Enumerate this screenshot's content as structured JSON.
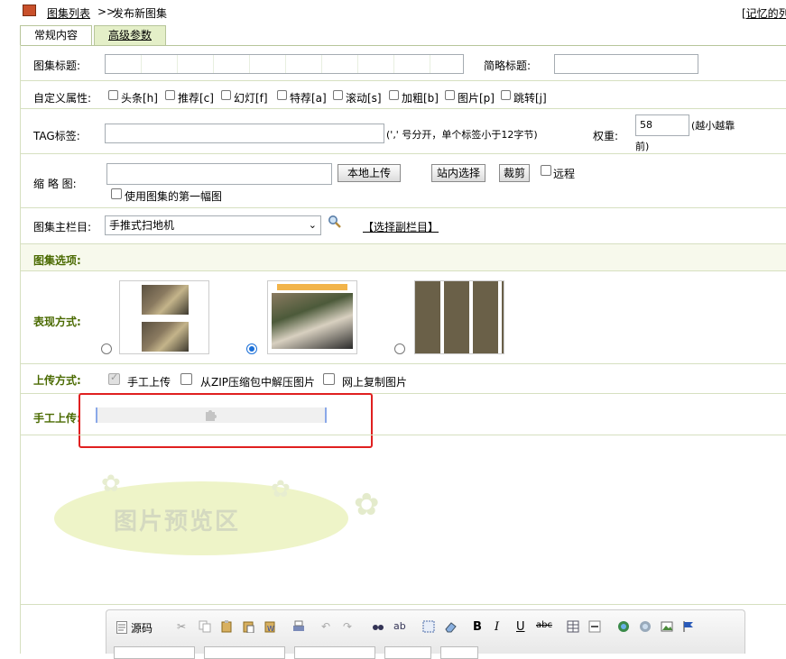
{
  "breadcrumb": {
    "list_link": "图集列表",
    "separator": ">>",
    "current": "发布新图集"
  },
  "top_right_link": "[记忆的",
  "top_right_link_tail": "列",
  "tabs": [
    {
      "label": "常规内容"
    },
    {
      "label": "高级参数"
    }
  ],
  "form": {
    "title_label": "图集标题:",
    "short_title_label": "简略标题:",
    "attributes_label": "自定义属性:",
    "attributes": [
      "头条[h]",
      "推荐[c]",
      "幻灯[f]",
      "特荐[a]",
      "滚动[s]",
      "加粗[b]",
      "图片[p]",
      "跳转[j]"
    ],
    "tag_label": "TAG标签:",
    "tag_hint": "(',' 号分开，单个标签小于12字节)",
    "weight_label": "权重:",
    "weight_value": "58",
    "weight_hint_line1": "(越小越靠",
    "weight_hint_line2": "前)",
    "thumb_label": "缩 略 图:",
    "local_upload": "本地上传",
    "site_select": "站内选择",
    "crop": "裁剪",
    "remote": "远程",
    "use_first": "使用图集的第一幅图",
    "column_label": "图集主栏目:",
    "column_value": "手推式扫地机",
    "choose_sub_column": "【选择副栏目】"
  },
  "section_title": "图集选项:",
  "display_label": "表现方式:",
  "upload_method_label": "上传方式:",
  "upload_methods": [
    "手工上传",
    "从ZIP压缩包中解压图片",
    "网上复制图片"
  ],
  "manual_upload_label": "手工上传:",
  "preview_area_text": "图片预览区",
  "editor_toolbar": {
    "source_label": "源码"
  },
  "colors": {
    "accent_green": "#4a6a00",
    "section_bg": "#f7f9ec",
    "highlight_red": "#e02020",
    "tab_active": "#e4efc8"
  }
}
